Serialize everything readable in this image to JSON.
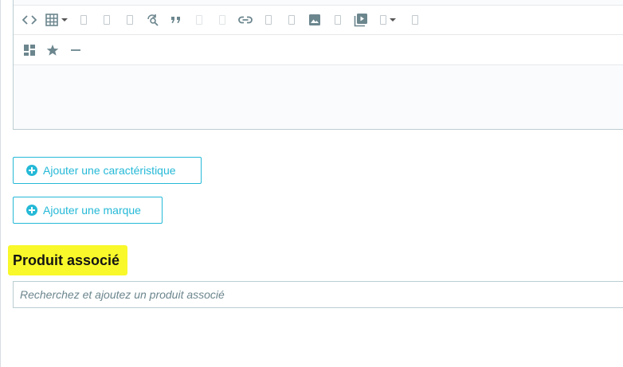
{
  "editor": {
    "toolbar_row1": [
      "code-icon",
      "table-icon",
      "missing-glyph-icon",
      "missing-glyph-icon",
      "missing-glyph-icon",
      "find-replace-icon",
      "blockquote-icon",
      "missing-glyph-icon",
      "missing-glyph-icon",
      "link-icon",
      "missing-glyph-icon",
      "missing-glyph-icon",
      "image-icon",
      "missing-glyph-icon",
      "media-icon",
      "missing-glyph-icon",
      "missing-glyph-icon"
    ],
    "toolbar_row2": [
      "template-icon",
      "star-icon",
      "horizontal-rule-icon"
    ]
  },
  "actions": {
    "add_feature_label": "Ajouter une caractéristique",
    "add_brand_label": "Ajouter une marque"
  },
  "related_product": {
    "title": "Produit associé",
    "search_placeholder": "Recherchez et ajoutez un produit associé",
    "search_value": ""
  },
  "colors": {
    "accent": "#25b9d7",
    "highlight": "#f8f82a",
    "border": "#bbcdd2",
    "icon": "#6c868e"
  }
}
